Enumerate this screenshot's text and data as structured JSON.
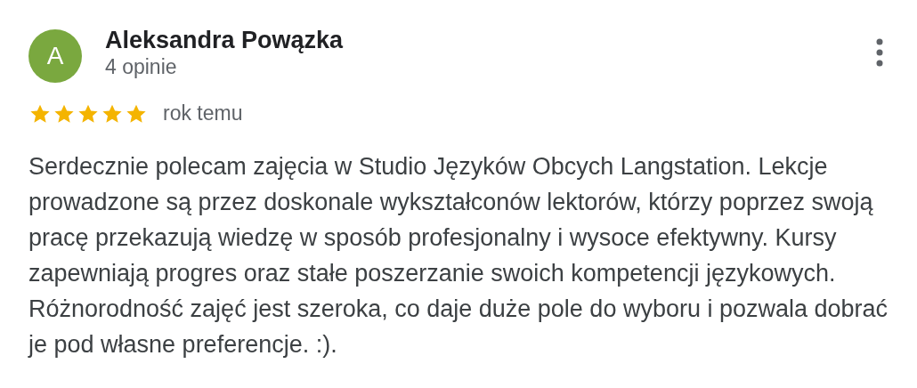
{
  "review": {
    "avatar_letter": "A",
    "author": "Aleksandra Powązka",
    "review_count": "4 opinie",
    "stars": 5,
    "time": "rok temu",
    "text": "Serdecznie polecam zajęcia w Studio Języków Obcych Langstation. Lekcje prowadzone są przez doskonale wykształconów lektorów, którzy poprzez swoją pracę przekazują wiedzę w sposób profesjonalny i wysoce efektywny. Kursy zapewniają progres oraz stałe poszerzanie swoich kompetencji językowych. Różnorodność zajęć jest szeroka, co daje duże pole do wyboru i pozwala dobrać je pod własne preferencje. :)."
  }
}
